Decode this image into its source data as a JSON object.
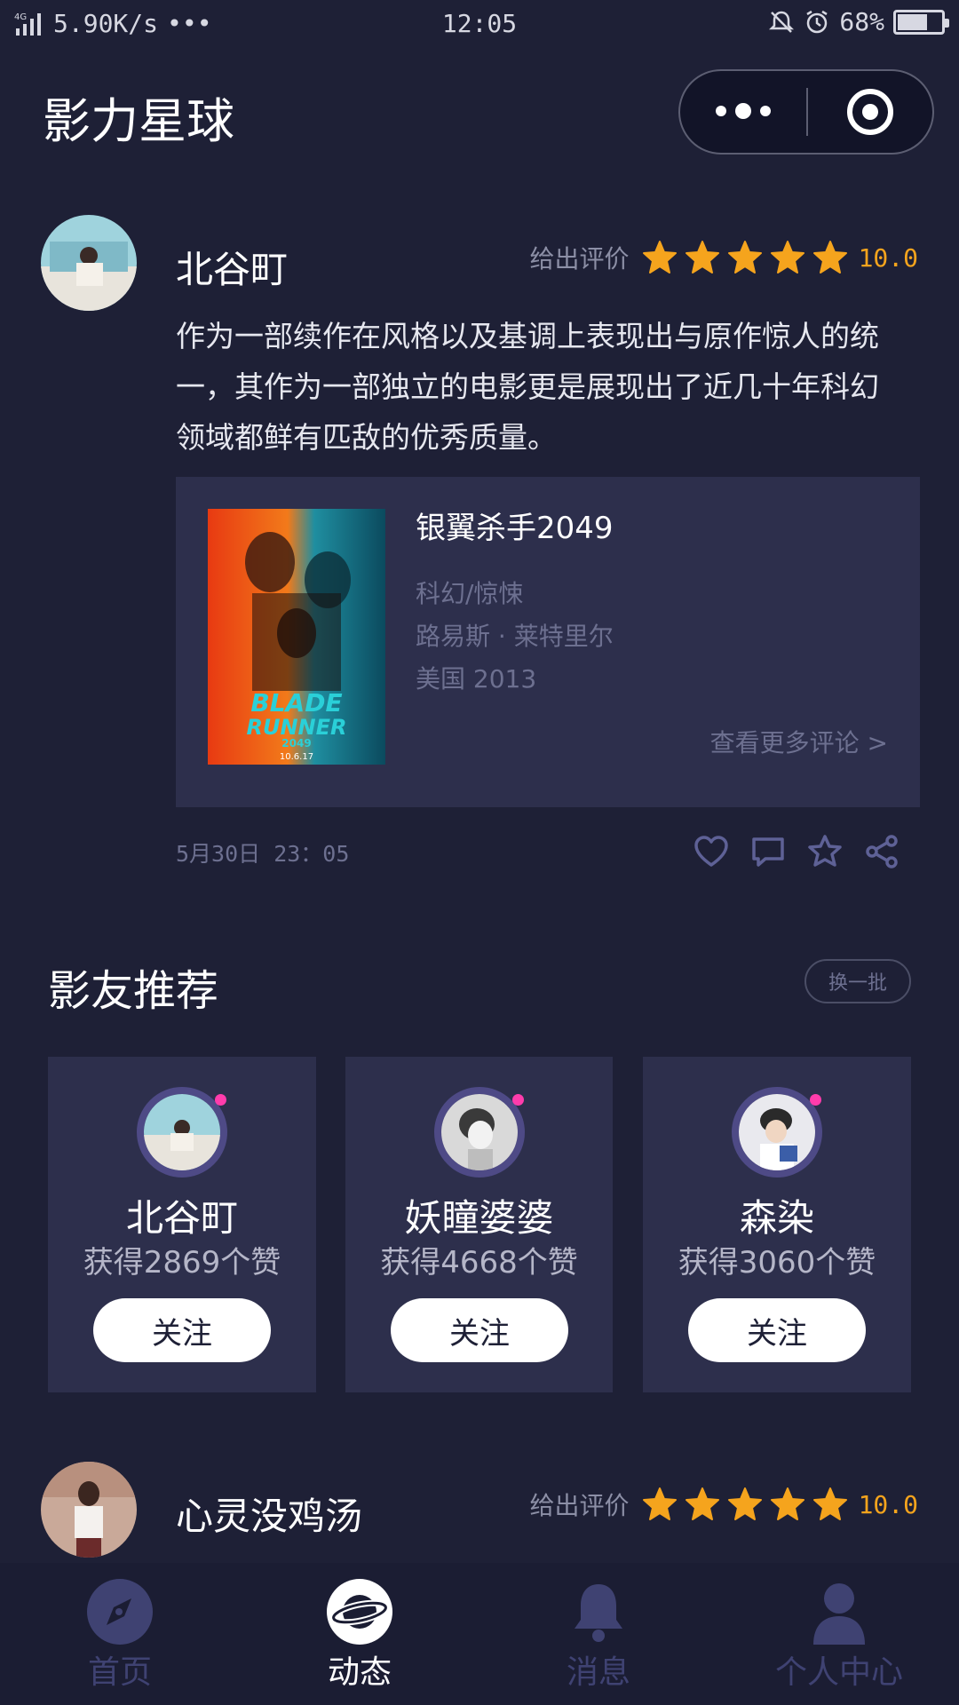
{
  "status_bar": {
    "network": "4G",
    "speed": "5.90K/s",
    "more": "•••",
    "time": "12:05",
    "battery": "68%",
    "battery_level": 0.68
  },
  "header": {
    "title": "影力星球"
  },
  "posts": [
    {
      "user": "北谷町",
      "rating_label": "给出评价",
      "stars": 5,
      "score": "10.0",
      "text": "作为一部续作在风格以及基调上表现出与原作惊人的统一，其作为一部独立的电影更是展现出了近几十年科幻领域都鲜有匹敌的优秀质量。",
      "movie": {
        "title": "银翼杀手2049",
        "genre": "科幻/惊悚",
        "director": "路易斯 · 莱特里尔",
        "country_year": "美国  2013",
        "more_link": "查看更多评论 >",
        "poster_text": {
          "line1": "BLADE",
          "line2": "RUNNER",
          "line3": "2049",
          "date": "10.6.17"
        }
      },
      "time": "5月30日 23：05"
    },
    {
      "user": "心灵没鸡汤",
      "rating_label": "给出评价",
      "stars": 5,
      "score": "10.0"
    }
  ],
  "recommend": {
    "title": "影友推荐",
    "refresh": "换一批",
    "users": [
      {
        "name": "北谷町",
        "likes": "获得2869个赞",
        "follow": "关注"
      },
      {
        "name": "妖瞳婆婆",
        "likes": "获得4668个赞",
        "follow": "关注"
      },
      {
        "name": "森染",
        "likes": "获得3060个赞",
        "follow": "关注"
      }
    ]
  },
  "tabbar": {
    "items": [
      {
        "label": "首页",
        "icon": "compass-icon",
        "active": false
      },
      {
        "label": "动态",
        "icon": "planet-icon",
        "active": true
      },
      {
        "label": "消息",
        "icon": "bell-icon",
        "active": false
      },
      {
        "label": "个人中心",
        "icon": "person-icon",
        "active": false
      }
    ]
  },
  "colors": {
    "background": "#1e2036",
    "card": "#2d2f4c",
    "star": "#f5a41d",
    "tab_inactive": "#3f4272",
    "online_dot": "#ff3cac"
  }
}
